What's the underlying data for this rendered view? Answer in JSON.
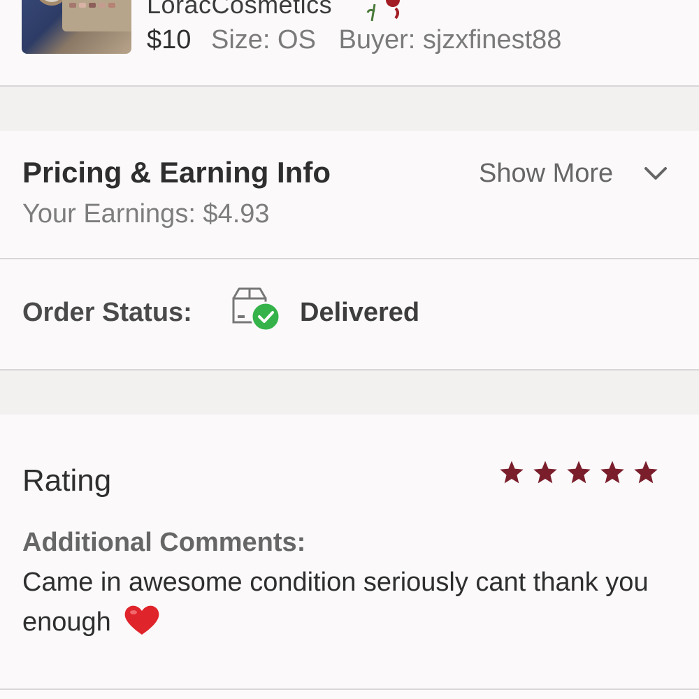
{
  "item": {
    "brand": "LoracCosmetics",
    "brand_emoji": "rose-icon",
    "price": "$10",
    "size": "Size: OS",
    "buyer": "Buyer: sjzxfinest88"
  },
  "pricing": {
    "title": "Pricing & Earning Info",
    "show_more": "Show More",
    "earnings": "Your Earnings: $4.93"
  },
  "order": {
    "label": "Order Status:",
    "status": "Delivered",
    "status_icon": "delivered-box-icon"
  },
  "rating": {
    "label": "Rating",
    "stars": 5,
    "max_stars": 5,
    "star_color": "#7a1e2c",
    "comments_label": "Additional Comments:",
    "comment": "Came in awesome condition seriously cant thank you enough",
    "comment_emoji": "heart-icon"
  },
  "colors": {
    "accent": "#7a1e2c",
    "success": "#35b34a"
  }
}
